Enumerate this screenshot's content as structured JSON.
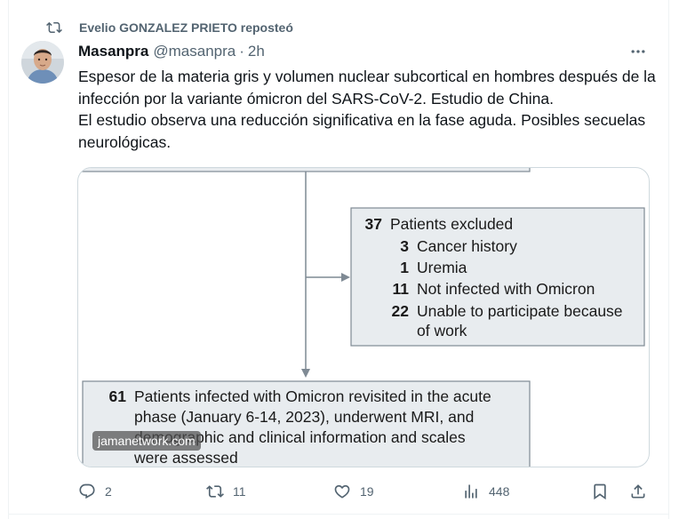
{
  "repost": {
    "text": "Evelio GONZALEZ PRIETO reposteó",
    "icon": "repost-icon"
  },
  "tweet": {
    "author_name": "Masanpra",
    "author_handle": "@masanpra",
    "separator": "·",
    "time": "2h",
    "text_lines": [
      "Espesor de la materia gris y volumen nuclear subcortical en hombres después de la infección por la variante ómicron del SARS-CoV-2. Estudio de China.",
      "El estudio observa una reducción significativa en la fase aguda. Posibles secuelas neurológicas."
    ]
  },
  "media": {
    "excluded": {
      "header_num": "37",
      "header_label": "Patients excluded",
      "items": [
        {
          "num": "3",
          "label": "Cancer history"
        },
        {
          "num": "1",
          "label": "Uremia"
        },
        {
          "num": "11",
          "label": "Not infected with Omicron"
        },
        {
          "num": "22",
          "label": "Unable to participate because"
        }
      ],
      "continuation": "of work"
    },
    "included": {
      "num": "61",
      "lines": [
        "Patients infected with Omicron revisited in the acute",
        "phase (January 6-14, 2023), underwent MRI, and",
        "demographic and clinical information and scales",
        "were assessed"
      ]
    },
    "watermark": "jamanetwork.com"
  },
  "actions": {
    "replies": "2",
    "reposts": "11",
    "likes": "19",
    "views": "448"
  },
  "colors": {
    "text": "#0f1419",
    "secondary": "#536471",
    "border": "#cfd9de",
    "box_fill": "#e8ecef",
    "box_border": "#7f8a94"
  }
}
